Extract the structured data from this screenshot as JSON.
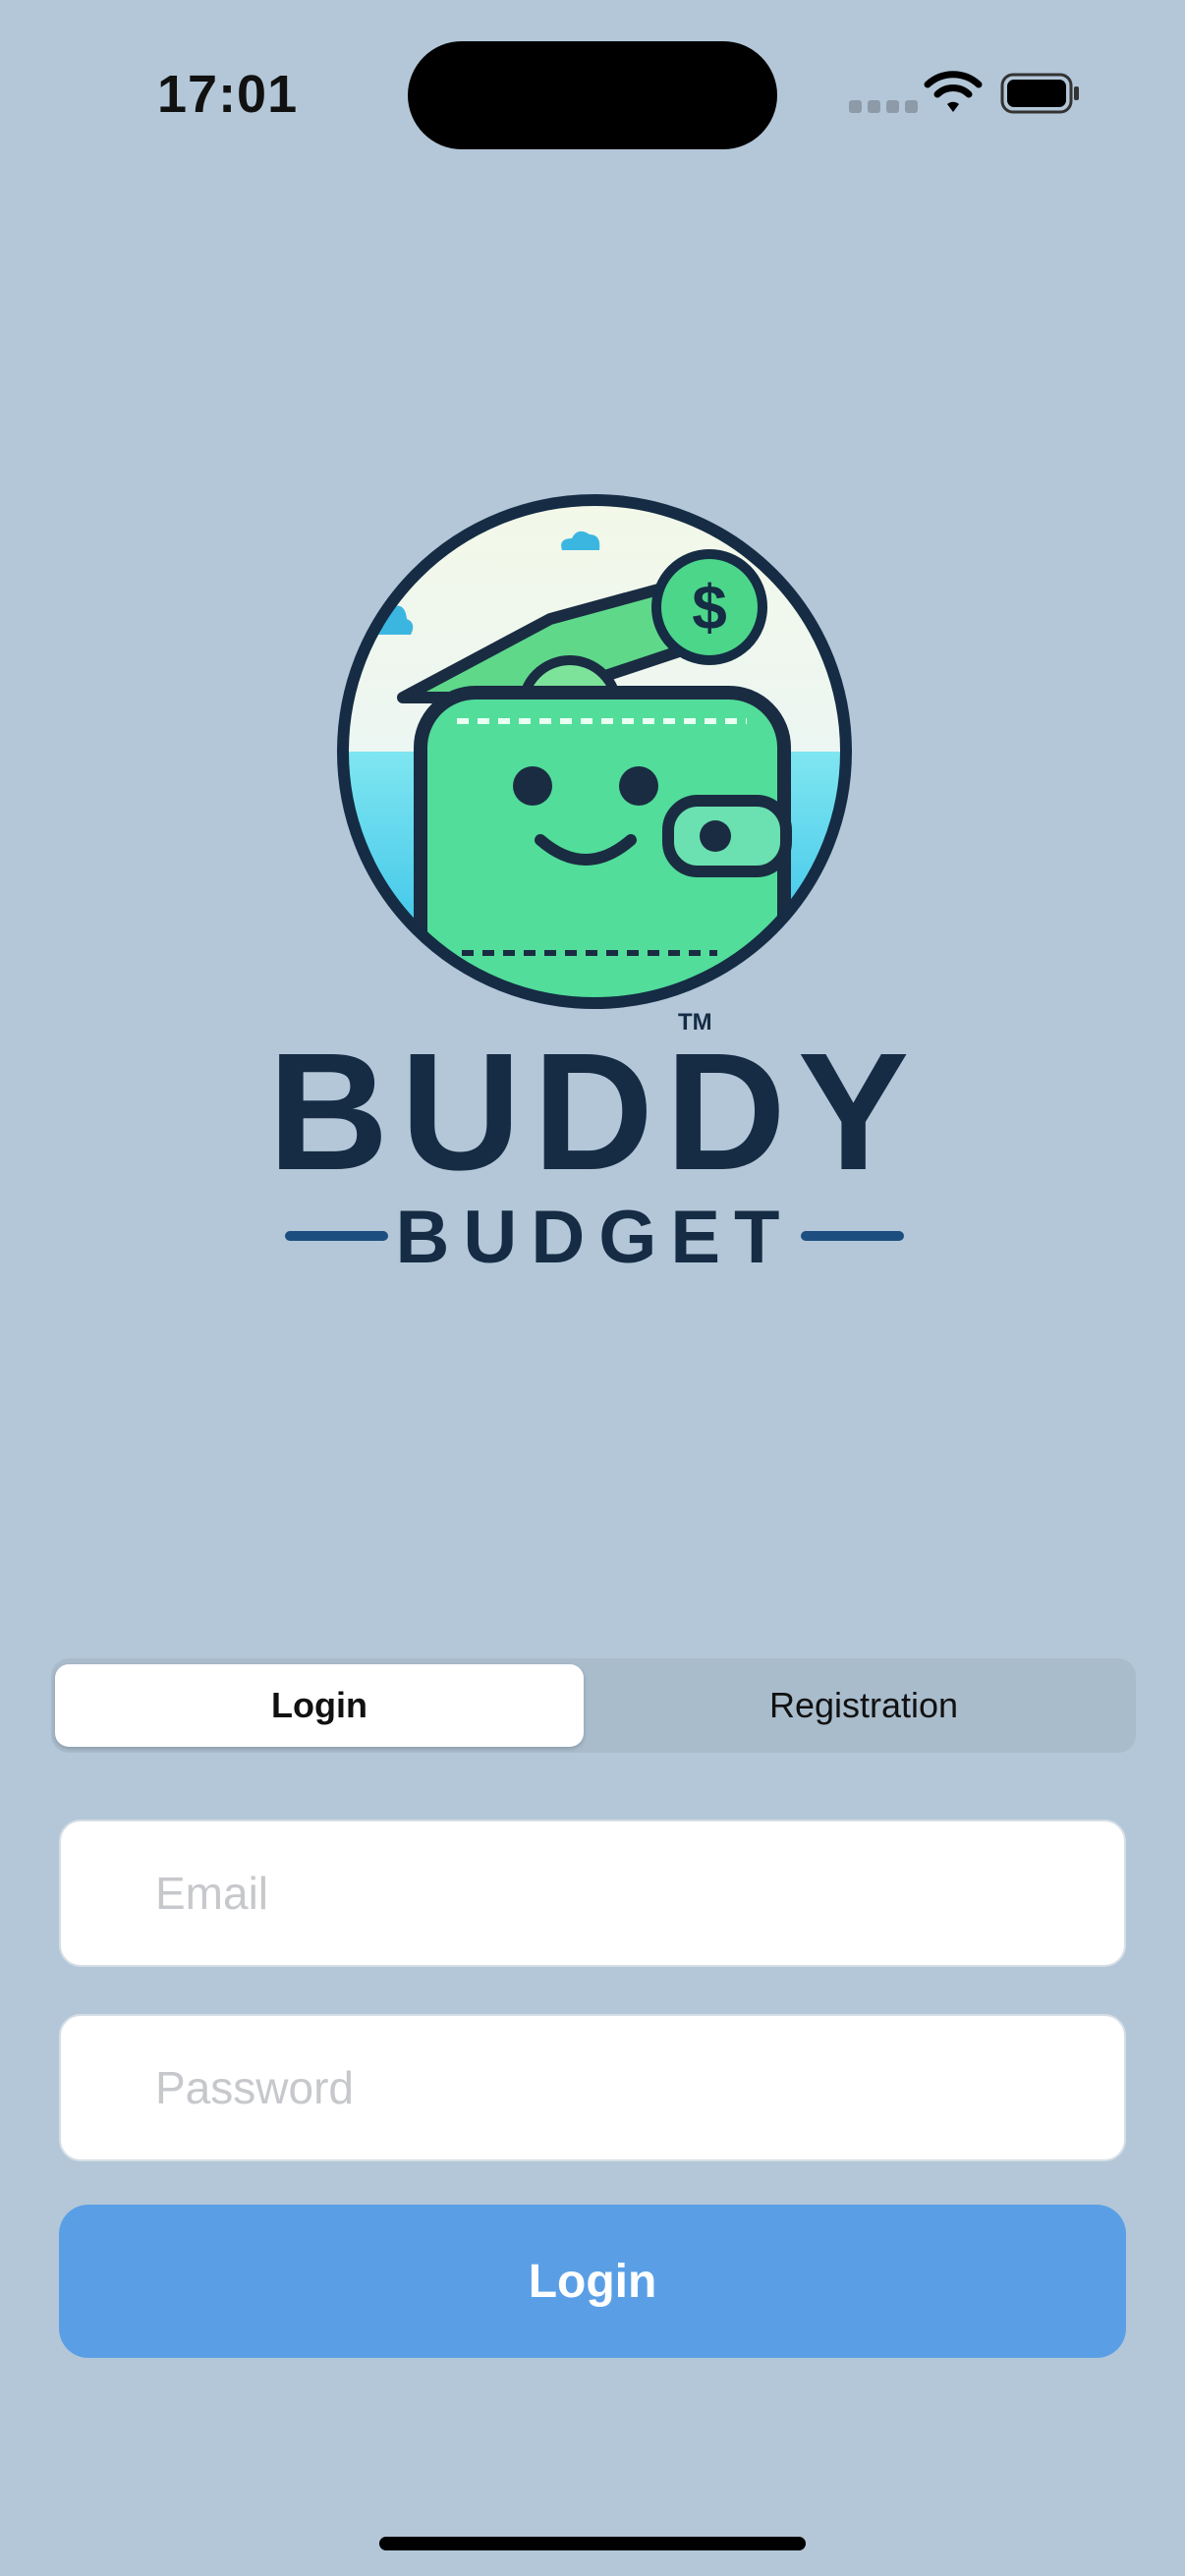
{
  "status_bar": {
    "time": "17:01"
  },
  "logo": {
    "title": "BUDDY",
    "subtitle": "BUDGET",
    "trademark": "TM",
    "coin_symbol": "$"
  },
  "tabs": [
    {
      "label": "Login",
      "selected": true
    },
    {
      "label": "Registration",
      "selected": false
    }
  ],
  "form": {
    "email": {
      "placeholder": "Email",
      "value": ""
    },
    "password": {
      "placeholder": "Password",
      "value": ""
    },
    "submit_label": "Login"
  },
  "colors": {
    "background": "#b3c7d8",
    "accent": "#5a9fe6",
    "logo_green": "#4cd68a",
    "logo_navy": "#152c44"
  }
}
